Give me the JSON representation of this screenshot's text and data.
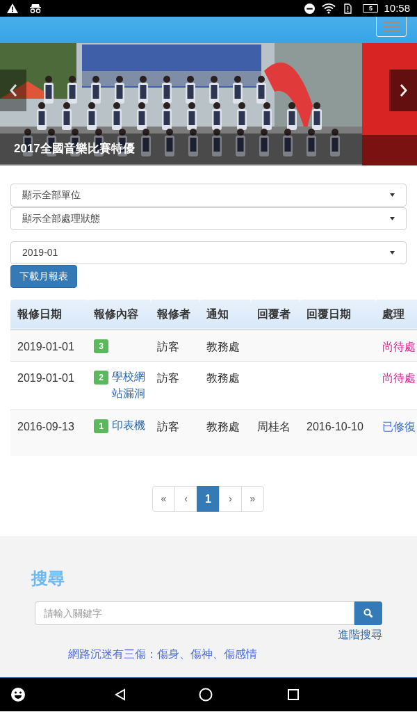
{
  "status_bar": {
    "battery": "5",
    "time": "10:58"
  },
  "carousel": {
    "caption": "2017全國音樂比賽特優"
  },
  "filters": [
    {
      "value": "顯示全部單位"
    },
    {
      "value": "顯示全部處理狀態"
    },
    {
      "value": "2019-01"
    }
  ],
  "download_button": "下載月報表",
  "table": {
    "columns": [
      "報修日期",
      "報修內容",
      "報修者",
      "通知",
      "回覆者",
      "回覆日期",
      "處理"
    ],
    "rows": [
      {
        "date": "2019-01-01",
        "badge": "3",
        "content": "",
        "reporter": "訪客",
        "notify": "教務處",
        "replier": "",
        "reply_date": "",
        "status": {
          "text": "尚待處",
          "kind": "pending"
        }
      },
      {
        "date": "2019-01-01",
        "badge": "2",
        "content": "學校網站漏洞",
        "reporter": "訪客",
        "notify": "教務處",
        "replier": "",
        "reply_date": "",
        "status": {
          "text": "尚待處",
          "kind": "pending"
        }
      },
      {
        "date": "2016-09-13",
        "badge": "1",
        "content": "印表機",
        "reporter": "訪客",
        "notify": "教務處",
        "replier": "周桂名",
        "reply_date": "2016-10-10",
        "status": {
          "text": "已修復",
          "kind": "done"
        }
      }
    ]
  },
  "pagination": [
    {
      "label": "«",
      "selected": false
    },
    {
      "label": "‹",
      "selected": false
    },
    {
      "label": "1",
      "selected": true
    },
    {
      "label": "›",
      "selected": false
    },
    {
      "label": "»",
      "selected": false
    }
  ],
  "search": {
    "heading": "搜尋",
    "placeholder": "請輸入關鍵字",
    "advanced_link": "進階搜尋"
  },
  "marquee": "網路沉迷有三傷：傷身、傷神、傷感情"
}
